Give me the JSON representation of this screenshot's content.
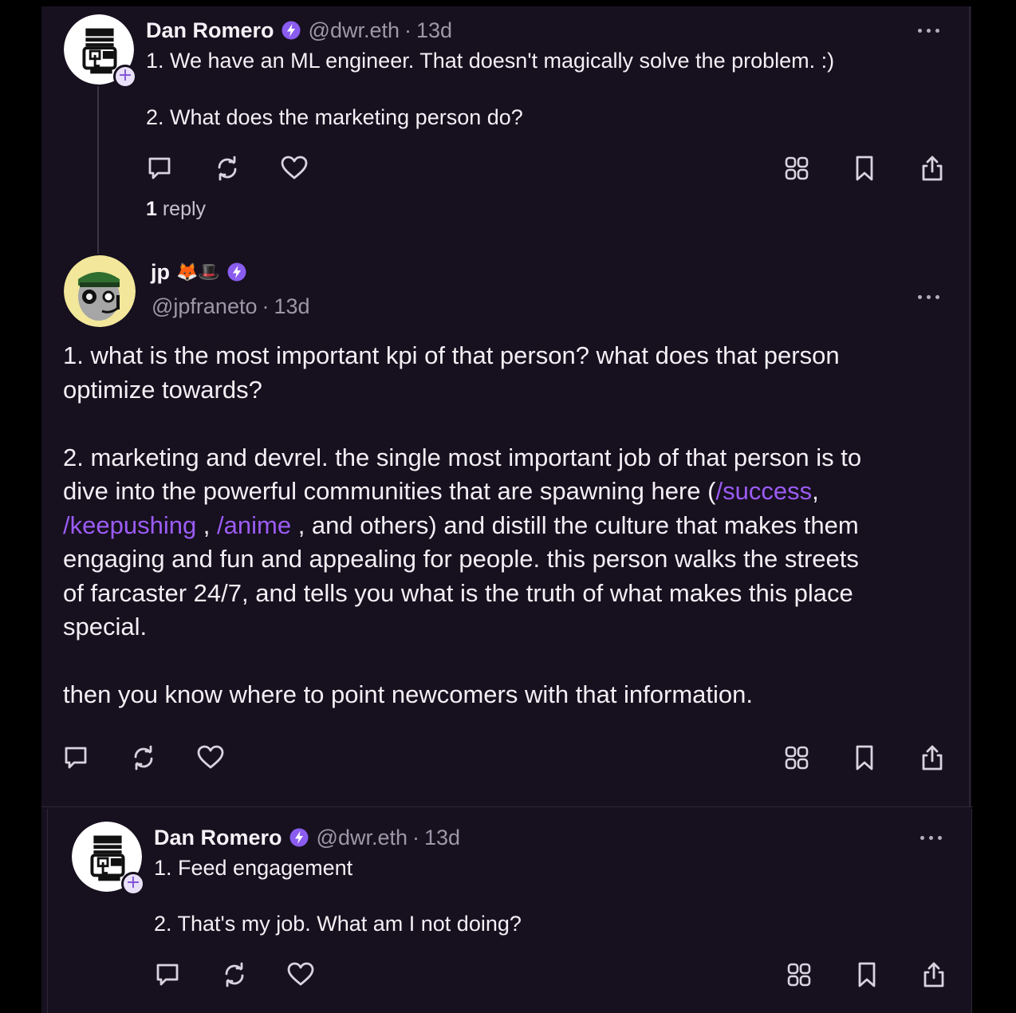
{
  "cast1": {
    "author": "Dan Romero",
    "handle": "@dwr.eth",
    "separator": "·",
    "time": "13d",
    "line1": "1. We have an ML engineer. That doesn't magically solve the problem. :)",
    "line2": "2. What does the marketing person do?",
    "reply_count": "1",
    "reply_label": "reply"
  },
  "cast2": {
    "author": "jp",
    "emojis": "🦊🎩",
    "handle": "@jpfraneto",
    "separator": "·",
    "time": "13d",
    "p1": "1. what is the most important kpi of that person? what does that person optimize towards?",
    "p2_l1": "2. marketing and devrel. the single most important job of that person is to",
    "p2_l2_pre": "dive into the powerful communities that are spawning here (",
    "link_success": "/success",
    "p2_l2_post": ",",
    "link_keepushing": "/keepushing",
    "comma_space": " , ",
    "link_anime": "/anime",
    "p2_l3_post": " , and others) and distill the culture that makes them",
    "p2_l4": "engaging and fun and appealing for people. this person walks the streets",
    "p2_l5": "of farcaster 24/7, and tells you what is the truth of what makes this place",
    "p2_l6": "special.",
    "p3": "then you know where to point newcomers with that information."
  },
  "cast3": {
    "author": "Dan Romero",
    "handle": "@dwr.eth",
    "separator": "·",
    "time": "13d",
    "line1": "1. Feed engagement",
    "line2": "2. That's my job. What am I not doing?"
  },
  "icons": {
    "reply": "comment-icon",
    "recast": "recast-icon",
    "like": "heart-icon",
    "apps": "grid-icon",
    "bookmark": "bookmark-icon",
    "share": "share-icon",
    "more": "more-icon",
    "badge": "power-badge-icon",
    "follow": "plus-icon"
  },
  "colors": {
    "background": "#17101f",
    "link": "#9b5cf5",
    "badge": "#8a5cf0",
    "muted": "#9e97a8"
  }
}
